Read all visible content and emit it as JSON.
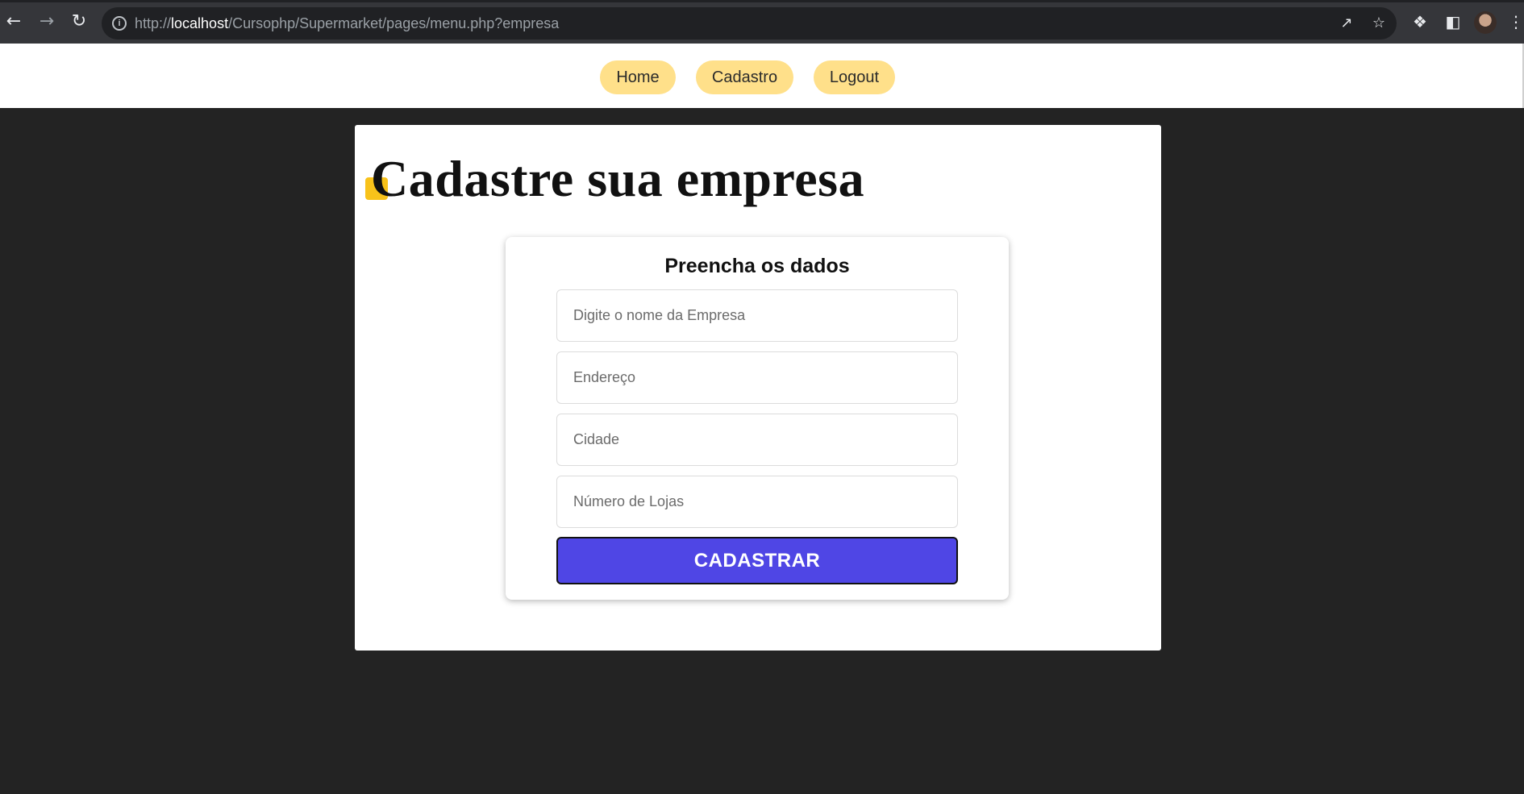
{
  "browser": {
    "url_prefix": "http://",
    "url_host": "localhost",
    "url_path": "/Cursophp/Supermarket/pages/menu.php?empresa",
    "icons": {
      "back": "back-arrow-icon",
      "forward": "forward-arrow-icon",
      "reload": "reload-icon",
      "info": "info-icon",
      "share": "share-icon",
      "star": "star-icon",
      "extensions": "puzzle-icon",
      "sidepanel": "side-panel-icon",
      "menu": "kebab-menu-icon"
    }
  },
  "nav": {
    "items": [
      {
        "label": "Home"
      },
      {
        "label": "Cadastro"
      },
      {
        "label": "Logout"
      }
    ]
  },
  "page": {
    "title": "Cadastre sua empresa"
  },
  "form": {
    "title": "Preencha os dados",
    "fields": [
      {
        "placeholder": "Digite o nome da Empresa",
        "value": ""
      },
      {
        "placeholder": "Endereço",
        "value": ""
      },
      {
        "placeholder": "Cidade",
        "value": ""
      },
      {
        "placeholder": "Número de Lojas",
        "value": ""
      }
    ],
    "submit_label": "CADASTRAR"
  },
  "colors": {
    "page_background": "#232323",
    "nav_pill": "#ffe08a",
    "accent": "#f8c21a",
    "submit_button": "#4f46e5"
  }
}
